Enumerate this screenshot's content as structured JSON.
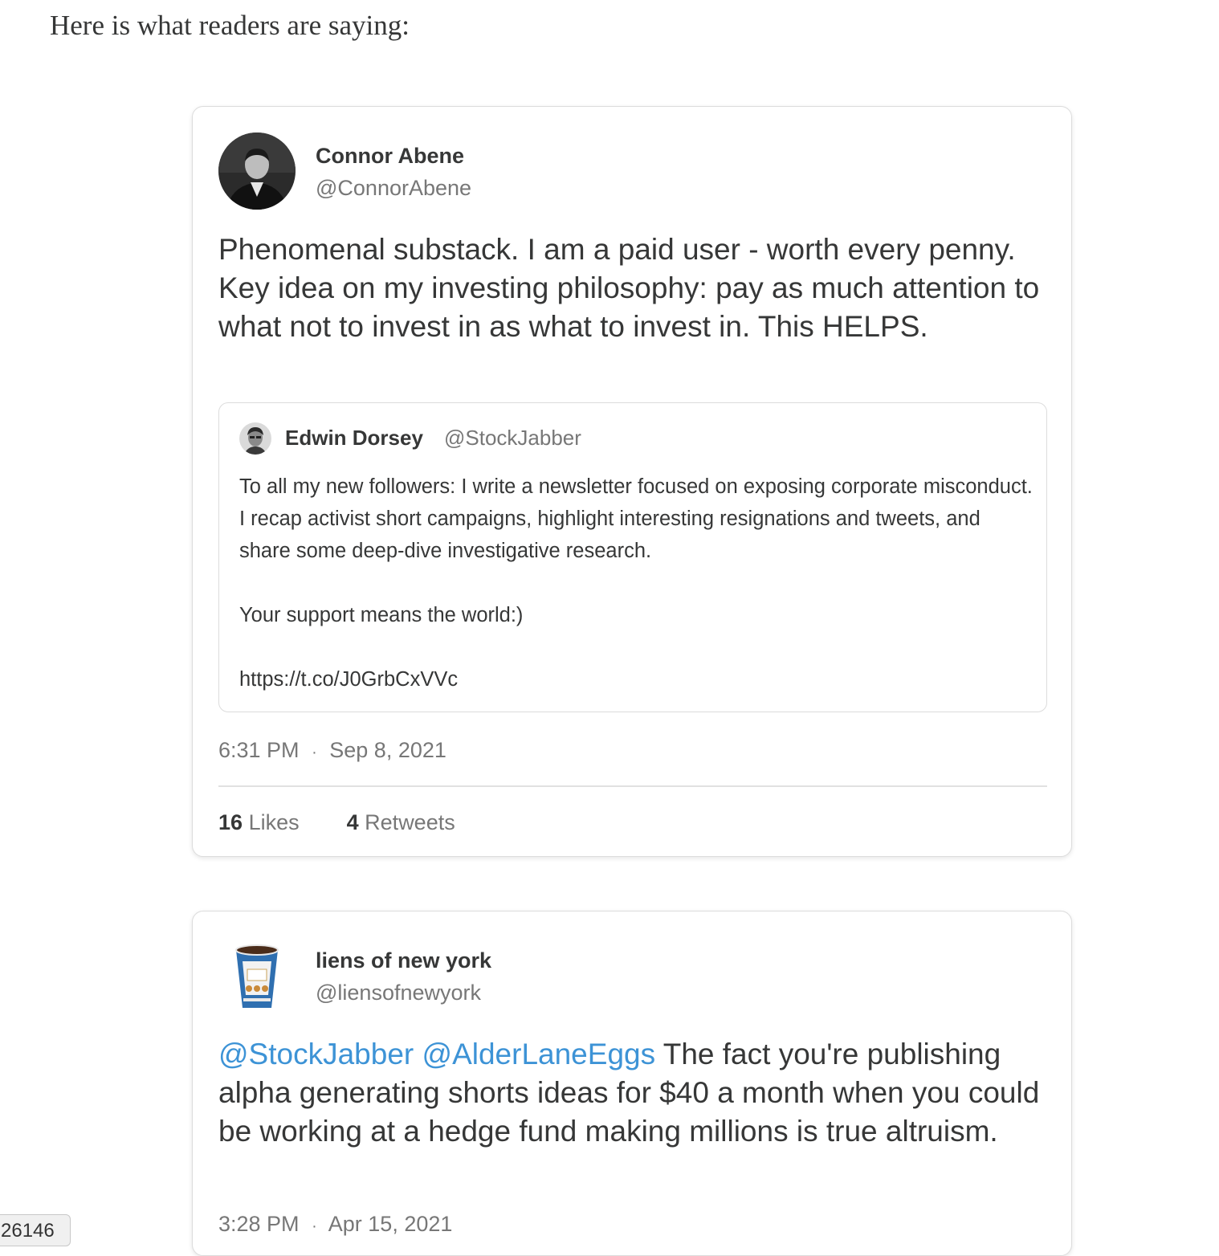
{
  "intro": "Here is what readers are saying:",
  "tweets": [
    {
      "name": "Connor Abene",
      "handle": "@ConnorAbene",
      "text": "Phenomenal substack. I am a paid user - worth every penny. Key idea on my investing philosophy: pay as much attention to what not to invest in as what to invest in. This HELPS.",
      "quote": {
        "name": "Edwin Dorsey",
        "handle": "@StockJabber",
        "paragraphs": [
          "To all my new followers: I write a newsletter focused on exposing corporate misconduct. I recap activist short campaigns, highlight interesting resignations and tweets, and share some deep-dive investigative research.",
          "Your support means the world:)",
          "https://t.co/J0GrbCxVVc"
        ]
      },
      "time": "6:31 PM",
      "separator": "·",
      "date": "Sep 8, 2021",
      "likes_count": "16",
      "likes_label": "Likes",
      "retweets_count": "4",
      "retweets_label": "Retweets"
    },
    {
      "name": "liens of new york",
      "handle": "@liensofnewyork",
      "mentions": [
        "@StockJabber",
        "@AlderLaneEggs"
      ],
      "text": "The fact you're publishing alpha generating shorts ideas for $40 a month when you could be working at a hedge fund making millions is true altruism.",
      "time": "3:28 PM",
      "separator": "·",
      "date": "Apr 15, 2021"
    }
  ],
  "corner_badge": "26146",
  "colors": {
    "mention": "#3d93d6",
    "text": "#363737",
    "muted": "#777777",
    "border": "#dcdcdc"
  }
}
